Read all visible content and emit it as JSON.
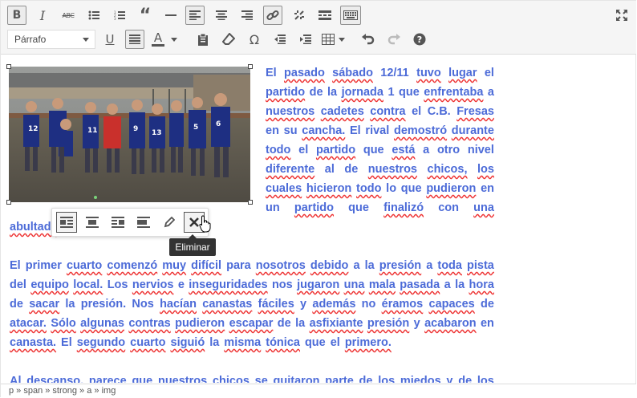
{
  "toolbar": {
    "format_select_value": "Párrafo",
    "row1": [
      {
        "name": "bold-button",
        "glyph": "B",
        "active": true
      },
      {
        "name": "italic-button",
        "glyph": "I",
        "active": false
      },
      {
        "name": "strikethrough-button",
        "glyph": "ABC",
        "active": false
      },
      {
        "name": "bullet-list-button",
        "glyph": "bullets",
        "active": false
      },
      {
        "name": "numbered-list-button",
        "glyph": "numbers",
        "active": false
      },
      {
        "name": "blockquote-button",
        "glyph": "“",
        "active": false
      },
      {
        "name": "horizontal-line-button",
        "glyph": "—",
        "active": false
      },
      {
        "name": "align-left-button",
        "glyph": "alignleft",
        "active": true
      },
      {
        "name": "align-center-button",
        "glyph": "aligncenter",
        "active": false
      },
      {
        "name": "align-right-button",
        "glyph": "alignright",
        "active": false
      },
      {
        "name": "insert-link-button",
        "glyph": "link",
        "active": true
      },
      {
        "name": "remove-link-button",
        "glyph": "unlink",
        "active": false
      },
      {
        "name": "read-more-button",
        "glyph": "more",
        "active": false
      },
      {
        "name": "toolbar-toggle-button",
        "glyph": "kitchensink",
        "active": true
      }
    ],
    "row2": [
      {
        "name": "underline-button",
        "glyph": "U"
      },
      {
        "name": "justify-button",
        "glyph": "justify",
        "active": true
      },
      {
        "name": "text-color-button",
        "glyph": "A"
      },
      {
        "name": "paste-text-button",
        "glyph": "paste"
      },
      {
        "name": "clear-formatting-button",
        "glyph": "eraser"
      },
      {
        "name": "special-character-button",
        "glyph": "Ω"
      },
      {
        "name": "decrease-indent-button",
        "glyph": "outdent"
      },
      {
        "name": "increase-indent-button",
        "glyph": "indent"
      },
      {
        "name": "table-button",
        "glyph": "table"
      },
      {
        "name": "undo-button",
        "glyph": "undo"
      },
      {
        "name": "redo-button",
        "glyph": "redo"
      },
      {
        "name": "help-button",
        "glyph": "?"
      }
    ]
  },
  "content": {
    "para1_lines": [
      [
        "El",
        "pasado",
        "sábado",
        "12/11",
        "tuvo",
        "lugar",
        "el"
      ],
      [
        "partido",
        "de",
        "la",
        "jornada",
        "1",
        "que",
        "enfrentaba",
        "a"
      ],
      [
        "nuestros",
        "cadetes",
        "contra",
        "el",
        "C.B.",
        "Fresas"
      ],
      [
        "en",
        "su",
        "cancha.",
        "El",
        "rival",
        "demostró",
        "durante"
      ],
      [
        "todo",
        "el",
        "partido",
        "que",
        "está",
        "a",
        "otro",
        "nivel"
      ],
      [
        "diferente",
        "al",
        "de",
        "nuestros",
        "chicos,",
        "los"
      ],
      [
        "cuales",
        "hicieron",
        "todo",
        "lo",
        "que",
        "pudieron",
        "en"
      ],
      [
        "un",
        "partido",
        "que",
        "finalizó",
        "con",
        "una"
      ]
    ],
    "para1_last": "abultado",
    "para2_lines": [
      "El primer cuarto comenzó muy difícil para nosotros debido a la presión a toda pista",
      "del equipo local. Los nervios e inseguridades nos jugaron una mala pasada a la hora",
      "de sacar la presión. Nos hacían canastas fáciles y además no éramos capaces de",
      "atacar. Sólo algunas contras pudieron escapar de la asfixiante presión y acabaron en"
    ],
    "para2_last": "canasta. El segundo cuarto siguió la misma tónica que el primero.",
    "para3_line": "Al descanso, parece que nuestros chicos se quitaron parte de los miedos y de los"
  },
  "image_toolbar": {
    "tooltip": "Eliminar"
  },
  "statusbar": {
    "path": "p » span » strong » a » img"
  },
  "colors": {
    "text": "#4c6bd8",
    "spell_underline": "#e33"
  }
}
